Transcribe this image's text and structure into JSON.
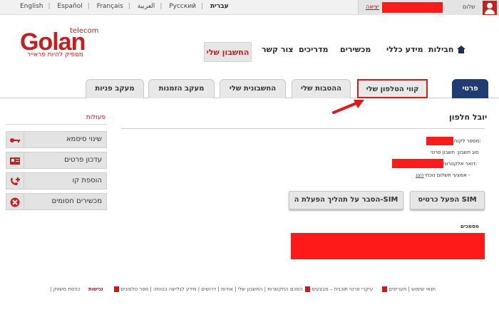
{
  "topbar": {
    "languages": [
      "English",
      "Español",
      "Français",
      "العربية",
      "Русский",
      "עברית"
    ],
    "active_language": "עברית",
    "exit_label": "יציאה",
    "greeting": "שלום"
  },
  "logo": {
    "telecom": "telecom",
    "brand": "Golan",
    "slogan": "מספיק להיות פראייר"
  },
  "main_nav": {
    "account": "החשבון שלי",
    "items": [
      "צור קשר",
      "מדריכים",
      "מכשירים",
      "מידע כללי",
      "חבילות"
    ]
  },
  "tabs": [
    {
      "label": "פרטי לקוח",
      "active": true
    },
    {
      "label": "קווי הטלפון שלי",
      "highlight": true
    },
    {
      "label": "ההטבות שלי"
    },
    {
      "label": "החשבונית שלי"
    },
    {
      "label": "מעקב הזמנות"
    },
    {
      "label": "מעקב פניות"
    }
  ],
  "sidebar": {
    "title": "פעולות",
    "buttons": [
      "שינוי סיסמא",
      "עדכון פרטים",
      "הוספת קו",
      "מכשירים חסומים"
    ],
    "icons": [
      "key-icon",
      "id-card-icon",
      "phone-plus-icon",
      "blocked-icon"
    ]
  },
  "content": {
    "customer_name": "יובל חלפון",
    "customer_number_label": "מספר לקוח:",
    "account_type": "סוג חשבון: חשבון פרטי",
    "email_label": "דואר אלקטרוני:",
    "payment_label": "אמצעי תשלום נוכחי -",
    "payment_link": "הצג",
    "sim_activate": "הפעל כרטיס SIM",
    "sim_explain": "הסבר על תהליך הפעלת ה-SIM",
    "documents_label": "מסמכים"
  },
  "footer": {
    "items": [
      "תנאי שימוש | תעריפים",
      "עיקרי פרטי תוכנית – מבצעים",
      "הסכם התקשרות | החשבון שלי | אודות | דרושים | מידע לגלישה בטוחה | ספר טלפונים",
      "נגישות",
      "| כניסת משווק"
    ]
  },
  "colors": {
    "brand_red": "#c61e1e",
    "nav_blue": "#1f3c73",
    "redaction": "#ff1a1a"
  }
}
